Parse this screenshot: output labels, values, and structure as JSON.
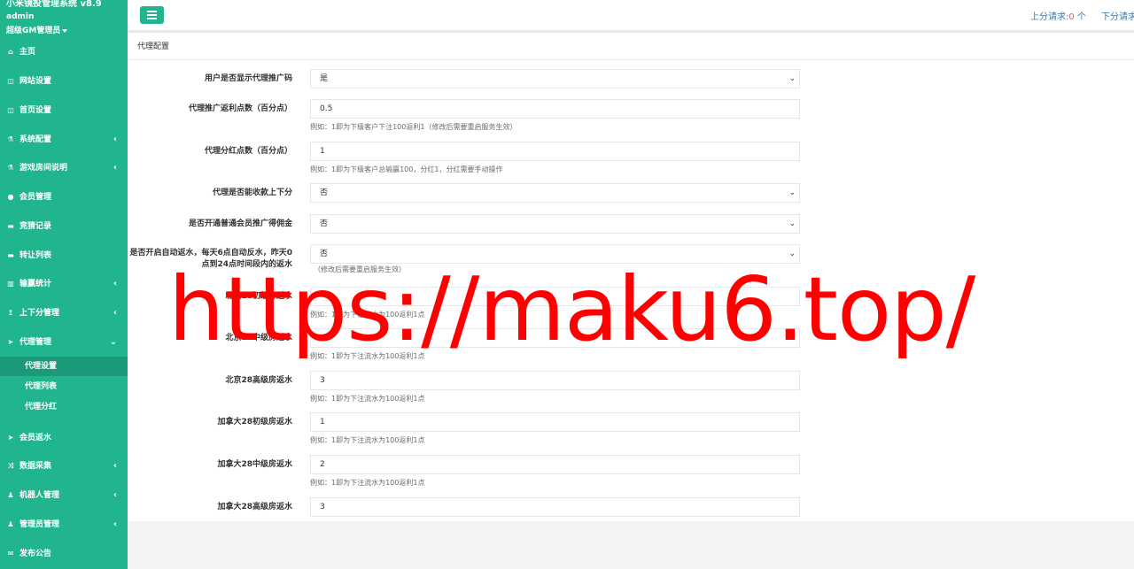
{
  "app": {
    "brand": "小米镜投管理系统 v8.9",
    "user": "admin",
    "role": "超级GM管理员"
  },
  "sidebar": {
    "items": [
      {
        "icon": "home-icon",
        "glyph": "⌂",
        "label": "主页",
        "chevron": ""
      },
      {
        "icon": "window-icon",
        "glyph": "◫",
        "label": "网站设置",
        "chevron": ""
      },
      {
        "icon": "window-icon",
        "glyph": "◫",
        "label": "首页设置",
        "chevron": ""
      },
      {
        "icon": "flask-icon",
        "glyph": "⚗",
        "label": "系统配置",
        "chevron": "‹"
      },
      {
        "icon": "flask-icon",
        "glyph": "⚗",
        "label": "游戏房间说明",
        "chevron": "‹"
      },
      {
        "icon": "user-icon",
        "glyph": "●",
        "label": "会员管理",
        "chevron": ""
      },
      {
        "icon": "car-icon",
        "glyph": "▬",
        "label": "竞猜记录",
        "chevron": ""
      },
      {
        "icon": "car-icon",
        "glyph": "▬",
        "label": "转让列表",
        "chevron": ""
      },
      {
        "icon": "chart-icon",
        "glyph": "▥",
        "label": "输赢统计",
        "chevron": "‹"
      },
      {
        "icon": "level-up-icon",
        "glyph": "↥",
        "label": "上下分管理",
        "chevron": "‹"
      },
      {
        "icon": "send-icon",
        "glyph": "➤",
        "label": "代理管理",
        "chevron": "⌄"
      }
    ],
    "subitems": [
      {
        "label": "代理设置"
      },
      {
        "label": "代理列表"
      },
      {
        "label": "代理分红"
      }
    ],
    "items_after": [
      {
        "icon": "send-icon",
        "glyph": "➤",
        "label": "会员返水",
        "chevron": ""
      },
      {
        "icon": "random-icon",
        "glyph": "⤨",
        "label": "数据采集",
        "chevron": "‹"
      },
      {
        "icon": "robot-icon",
        "glyph": "♟",
        "label": "机器人管理",
        "chevron": "‹"
      },
      {
        "icon": "robot-icon",
        "glyph": "♟",
        "label": "管理员管理",
        "chevron": "‹"
      },
      {
        "icon": "comment-icon",
        "glyph": "✉",
        "label": "发布公告",
        "chevron": ""
      }
    ]
  },
  "topbar": {
    "up_label": "上分请求:",
    "up_count": "0",
    "up_unit": " 个",
    "down_label": "下分请求"
  },
  "panel": {
    "title": "代理配置"
  },
  "form": {
    "fields": [
      {
        "label": "用户是否显示代理推广码",
        "value": "是",
        "type": "select",
        "help": ""
      },
      {
        "label": "代理推广返利点数（百分点）",
        "value": "0.5",
        "type": "input",
        "help": "例如：1即为下级客户下注100返利1（修改后需要重启服务生效）"
      },
      {
        "label": "代理分红点数（百分点）",
        "value": "1",
        "type": "input",
        "help": "例如：1即为下级客户总输赢100，分红1，分红需要手动操作"
      },
      {
        "label": "代理是否能收款上下分",
        "value": "否",
        "type": "select",
        "help": ""
      },
      {
        "label": "是否开通普通会员推广得佣金",
        "value": "否",
        "type": "select",
        "help": ""
      },
      {
        "label": "是否开启自动返水，每天6点自动反水，昨天0点到24点时间段内的返水",
        "value": "否",
        "type": "select",
        "help": "（修改后需要重启服务生效）"
      },
      {
        "label": "北京28初级房返水",
        "value": "",
        "type": "input",
        "help": "例如：1即为下注流水为100返利1点"
      },
      {
        "label": "北京28中级房返水",
        "value": "",
        "type": "input",
        "help": "例如：1即为下注流水为100返利1点"
      },
      {
        "label": "北京28高级房返水",
        "value": "3",
        "type": "input",
        "help": "例如：1即为下注流水为100返利1点"
      },
      {
        "label": "加拿大28初级房返水",
        "value": "1",
        "type": "input",
        "help": "例如：1即为下注流水为100返利1点"
      },
      {
        "label": "加拿大28中级房返水",
        "value": "2",
        "type": "input",
        "help": "例如：1即为下注流水为100返利1点"
      },
      {
        "label": "加拿大28高级房返水",
        "value": "3",
        "type": "input",
        "help": "例如：1即为下注流水为100返利1点"
      }
    ]
  },
  "watermark": "https://maku6.top/"
}
